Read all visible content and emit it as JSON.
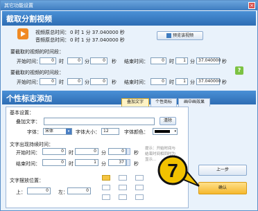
{
  "window": {
    "title": "其它功能设置",
    "close": "×"
  },
  "section1": {
    "title": "截取分割视频",
    "video_duration_label": "视频原总时间：",
    "video_duration": "0    时   1    分  37.040000 秒",
    "audio_duration_label": "音频原总时间：",
    "audio_duration": "0    时   1    分  37.040000 秒",
    "preview_button": "预览该视频",
    "range1_title": "要截取的视频的时间段：",
    "range2_title": "要截取的视频的时间段：",
    "start_label": "开始时间：",
    "end_label": "结束时间：",
    "hour": "时",
    "minute": "分",
    "second": "秒",
    "r1_start": {
      "h": "0",
      "m": "0",
      "s": "0"
    },
    "r1_end": {
      "h": "0",
      "m": "1",
      "s": "37.040000"
    },
    "r2_start": {
      "h": "0",
      "m": "0",
      "s": "0"
    },
    "r2_end": {
      "h": "0",
      "m": "1",
      "s": "37.040000"
    },
    "help": "?"
  },
  "section2": {
    "title": "个性标志添加",
    "tabs": [
      "叠加文字",
      "个性商标",
      "画中画效果"
    ],
    "basic_settings": "基本设置：",
    "overlay_text_label": "叠加文字：",
    "overlay_text_value": "",
    "clear_button": "清除",
    "font_label": "字体：",
    "font_value": "宋体",
    "font_size_label": "字体大小：",
    "font_size_value": "12",
    "font_color_label": "字体颜色：",
    "time_range_title": "文字出现持续时间：",
    "start_label": "开始时间：",
    "end_label": "结束时间：",
    "hour": "时",
    "minute": "分",
    "second": "秒",
    "t_start": {
      "h": "0",
      "m": "0",
      "s": "0"
    },
    "t_end": {
      "h": "0",
      "m": "1",
      "s": "37"
    },
    "hint": "提示：开始时间与结束时间相同时为显示...",
    "position_title": "文字摆放位置：",
    "top_label": "上：",
    "top_value": "0",
    "left_label": "左：",
    "left_value": "0",
    "prev_button": "上一步",
    "ok_button": "确认"
  },
  "overlay_badge": "7",
  "colors": {
    "accent": "#3e7cc0",
    "ok": "#f5b82e",
    "badge": "#f2c200"
  }
}
